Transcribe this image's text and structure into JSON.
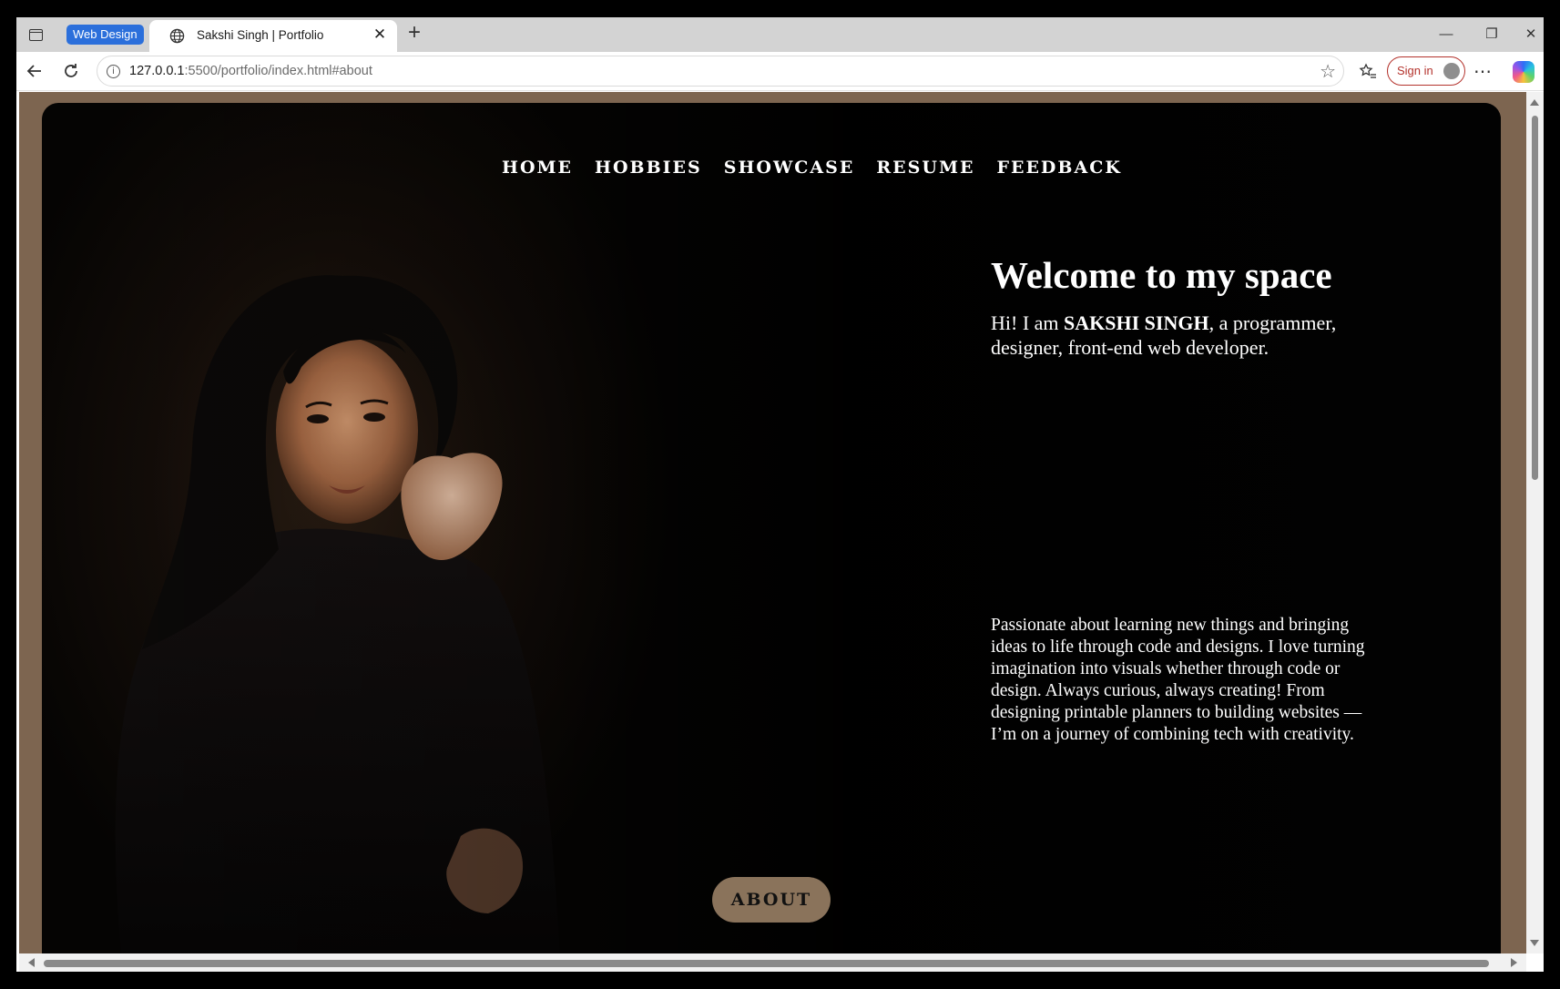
{
  "browser": {
    "tab_group": "Web Design",
    "tab_title": "Sakshi Singh | Portfolio",
    "url_host": "127.0.0.1",
    "url_path": ":5500/portfolio/index.html#about",
    "sign_in": "Sign in",
    "new_tab": "+",
    "minimize": "—",
    "restore": "❐",
    "close": "✕",
    "tab_close": "✕"
  },
  "page": {
    "nav": [
      "HOME",
      "HOBBIES",
      "SHOWCASE",
      "RESUME",
      "FEEDBACK"
    ],
    "welcome": "Welcome to my space",
    "intro_prefix": "Hi! I am ",
    "intro_name": "SAKSHI SINGH",
    "intro_suffix": ", a programmer, designer, front-end web developer.",
    "passion": "Passionate about learning new things and bringing ideas to life through code and designs. I love turning imagination into visuals whether through code or design. Always curious, always creating! From designing printable planners to building websites — I’m on a journey of combining tech with creativity.",
    "about_button": "ABOUT"
  },
  "colors": {
    "frame_brown": "#7d6550",
    "button_brown": "#8a735b",
    "tab_group_blue": "#2b6fdb",
    "signin_red": "#b4332d"
  }
}
